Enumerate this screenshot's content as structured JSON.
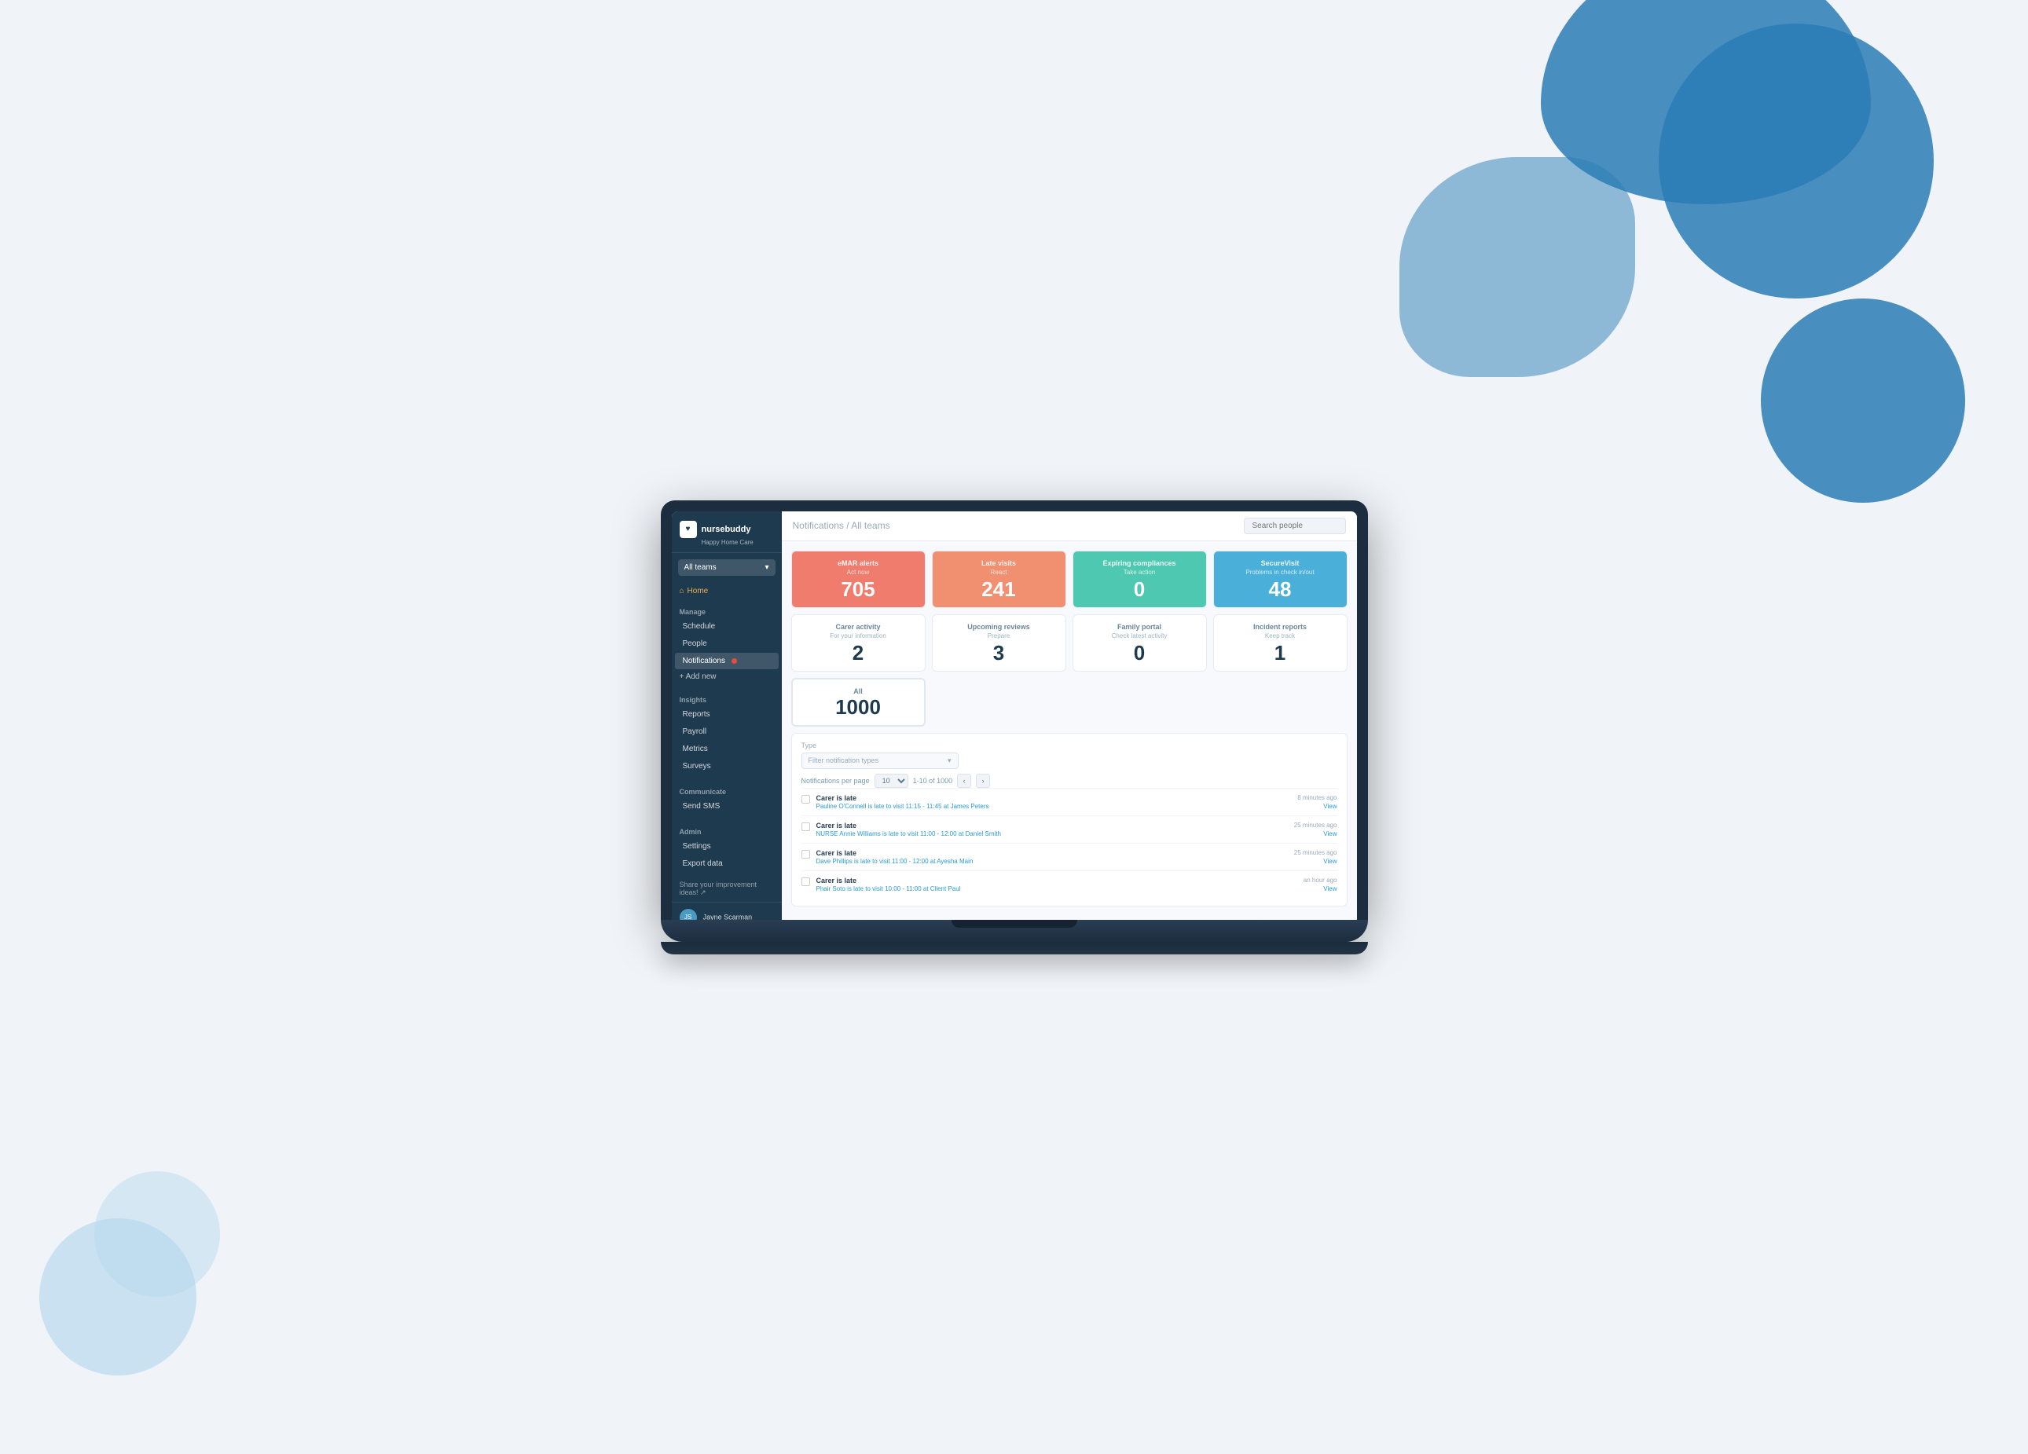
{
  "background": {
    "blob_color": "#2a7db5",
    "light_blob_color": "#b8d9ee"
  },
  "laptop": {
    "screen_bg": "#1c2d3f"
  },
  "sidebar": {
    "logo_text": "nursebuddy",
    "logo_sub": "Happy Home Care",
    "team_selector": "All teams",
    "home_label": "Home",
    "sections": [
      {
        "label": "Manage",
        "items": [
          "Schedule",
          "People",
          "Notifications",
          "+ Add new"
        ]
      },
      {
        "label": "Insights",
        "items": [
          "Reports",
          "Payroll",
          "Metrics",
          "Surveys"
        ]
      },
      {
        "label": "Communicate",
        "items": [
          "Send SMS"
        ]
      },
      {
        "label": "Admin",
        "items": [
          "Settings",
          "Export data"
        ]
      }
    ],
    "share_ideas": "Share your improvement ideas! ↗",
    "user_name": "Jayne Scarman"
  },
  "header": {
    "breadcrumb_part1": "Notifications",
    "breadcrumb_sep": " / ",
    "breadcrumb_part2": "All teams",
    "search_placeholder": "Search people"
  },
  "stats": [
    {
      "title": "eMAR alerts",
      "subtitle": "Act now",
      "value": "705",
      "style": "red"
    },
    {
      "title": "Late visits",
      "subtitle": "React",
      "value": "241",
      "style": "orange"
    },
    {
      "title": "Expiring compliances",
      "subtitle": "Take action",
      "value": "0",
      "style": "teal"
    },
    {
      "title": "SecureVisit",
      "subtitle": "Problems in check in/out",
      "value": "48",
      "style": "blue"
    },
    {
      "title": "Carer activity",
      "subtitle": "For your information",
      "value": "2",
      "style": "white"
    },
    {
      "title": "Upcoming reviews",
      "subtitle": "Prepare",
      "value": "3",
      "style": "white"
    },
    {
      "title": "Family portal",
      "subtitle": "Check latest activity",
      "value": "0",
      "style": "white"
    },
    {
      "title": "Incident reports",
      "subtitle": "Keep track",
      "value": "1",
      "style": "white"
    }
  ],
  "all_card": {
    "title": "All",
    "value": "1000"
  },
  "filter": {
    "label": "Type",
    "placeholder": "Filter notification types"
  },
  "pagination": {
    "per_page_label": "Notifications per page",
    "per_page_value": "10",
    "range": "1-10 of 1000"
  },
  "notifications": [
    {
      "title": "Carer is late",
      "time": "8 minutes ago",
      "detail": "Pauline O'Connell is late to visit 11:15 - 11:45 at James Peters",
      "link_text": "Pauline O'Connell is late to visit 11:15 - 11:45 at James Peters"
    },
    {
      "title": "Carer is late",
      "time": "25 minutes ago",
      "detail": "NURSE Annie Williams is late to visit 11:00 - 12:00 at Daniel Smith",
      "link_text": "NURSE Annie Williams is late to visit 11:00 - 12:00 at Daniel Smith"
    },
    {
      "title": "Carer is late",
      "time": "25 minutes ago",
      "detail": "Dave Phillips is late to visit 11:00 - 12:00 at Ayesha Main",
      "link_text": "Dave Phillips is late to visit 11:00 - 12:00 at Ayesha Main"
    },
    {
      "title": "Carer is late",
      "time": "an hour ago",
      "detail": "Phair Soto is late to visit 10:00 - 11:00 at Client Paul",
      "link_text": "Phair Soto is late to visit 10:00 - 11:00 at Client Paul"
    }
  ],
  "view_label": "View"
}
